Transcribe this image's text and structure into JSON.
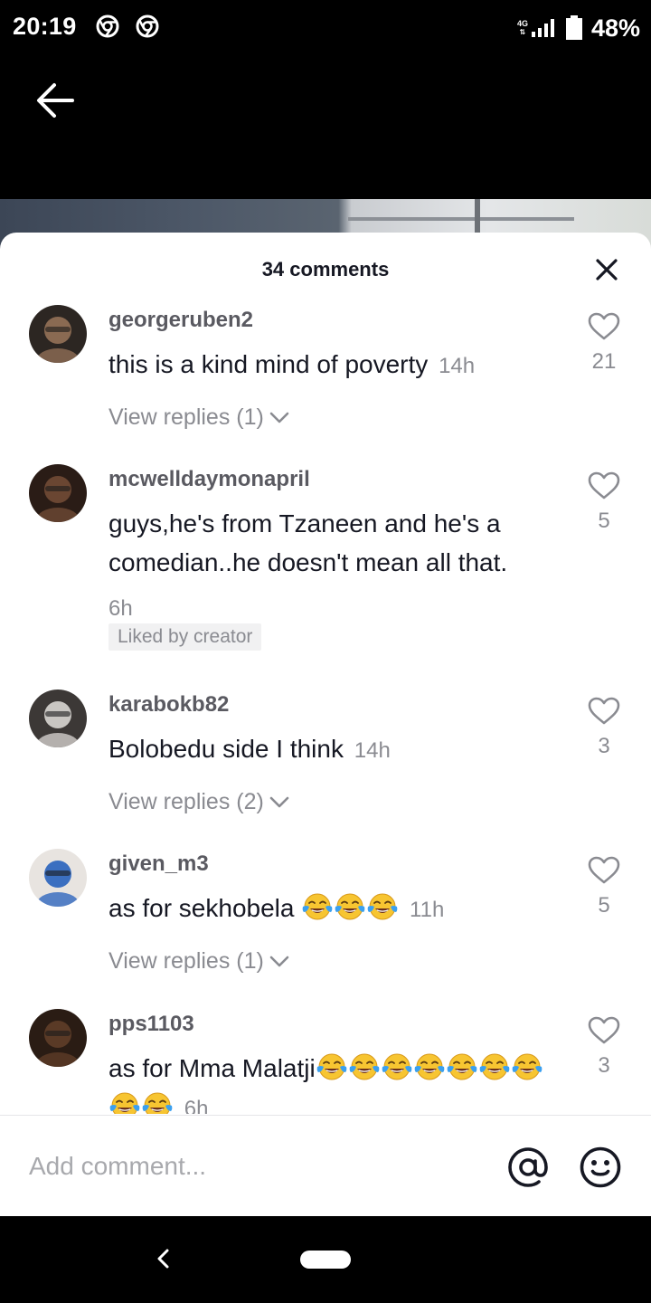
{
  "status_bar": {
    "time": "20:19",
    "network_label": "4G",
    "battery": "48%"
  },
  "header": {
    "comments_count": "34 comments"
  },
  "comments": [
    {
      "username": "georgeruben2",
      "text": "this is a kind mind of poverty",
      "emoji_count": 0,
      "time": "14h",
      "likes": "21",
      "replies": "View replies (1)",
      "avatar_colors": [
        "#8a6a52",
        "#2c2622"
      ]
    },
    {
      "username": "mcwelldaymonapril",
      "text": "guys,he's from Tzaneen and he's a comedian..he doesn't mean all that.",
      "emoji_count": 0,
      "time": "6h",
      "likes": "5",
      "badge": "Liked by creator",
      "avatar_colors": [
        "#6a4632",
        "#2a1c16"
      ]
    },
    {
      "username": "karabokb82",
      "text": "Bolobedu side I think",
      "emoji_count": 0,
      "time": "14h",
      "likes": "3",
      "replies": "View replies (2)",
      "avatar_colors": [
        "#c9c6c2",
        "#3c3836"
      ]
    },
    {
      "username": "given_m3",
      "text": "as for sekhobela",
      "emoji_count": 3,
      "time": "11h",
      "likes": "5",
      "replies": "View replies (1)",
      "avatar_colors": [
        "#3b6fc0",
        "#e8e4e0"
      ]
    },
    {
      "username": "pps1103",
      "text": "as for Mma Malatji",
      "emoji_count": 9,
      "time": "6h",
      "likes": "3",
      "avatar_colors": [
        "#5a3a26",
        "#2a1c14"
      ]
    }
  ],
  "input": {
    "placeholder": "Add comment..."
  },
  "icons": {
    "back": "arrow-left-icon",
    "close": "close-icon",
    "like": "heart-outline-icon",
    "chevron": "chevron-down-icon",
    "mention": "at-sign-icon",
    "emoji": "smiley-icon",
    "reaction": "tears-of-joy-emoji"
  },
  "colors": {
    "primary_text": "#161823",
    "secondary_text": "#8a8b91",
    "username": "#5a5a61"
  }
}
